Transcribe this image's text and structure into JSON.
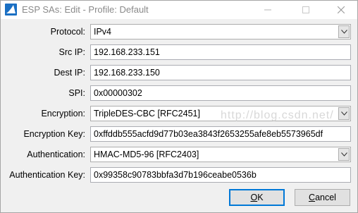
{
  "window": {
    "title": "ESP SAs: Edit - Profile: Default",
    "title_icon": "wireshark-fin-icon",
    "controls": {
      "minimize_icon": "minimize-icon",
      "maximize_icon": "maximize-icon",
      "close_icon": "close-icon"
    }
  },
  "form": {
    "protocol": {
      "label": "Protocol:",
      "value": "IPv4"
    },
    "src_ip": {
      "label": "Src IP:",
      "value": "192.168.233.151"
    },
    "dest_ip": {
      "label": "Dest IP:",
      "value": "192.168.233.150"
    },
    "spi": {
      "label": "SPI:",
      "value": "0x00000302"
    },
    "encryption": {
      "label": "Encryption:",
      "value": "TripleDES-CBC [RFC2451]"
    },
    "encryption_key": {
      "label": "Encryption Key:",
      "value": "0xffddb555acfd9d77b03ea3843f2653255afe8eb5573965df"
    },
    "authentication": {
      "label": "Authentication:",
      "value": "HMAC-MD5-96 [RFC2403]"
    },
    "authentication_key": {
      "label": "Authentication Key:",
      "value": "0x99358c90783bbfa3d7b196ceabe0536b"
    }
  },
  "watermark": "http://blog.csdn.net/",
  "buttons": {
    "ok": "OK",
    "cancel": "Cancel"
  },
  "colors": {
    "accent": "#0078d7",
    "title_text": "#8a8a8a",
    "dialog_bg": "#f0f0f0"
  }
}
